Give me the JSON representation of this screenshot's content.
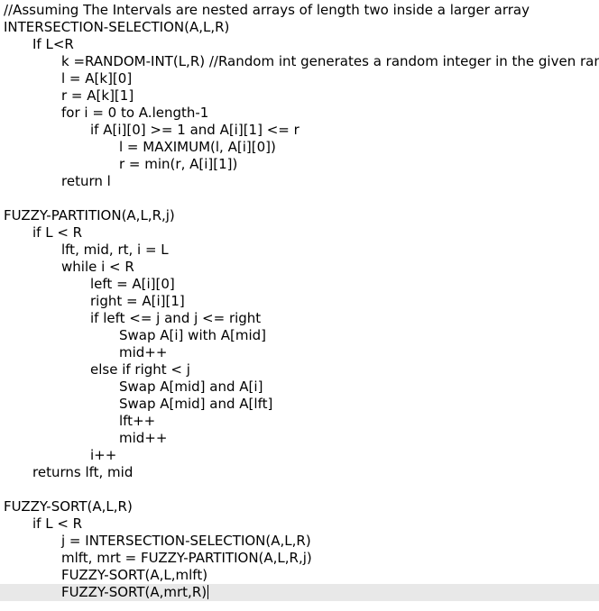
{
  "editor": {
    "indent_unit": "    ",
    "active_line": 34,
    "highlight_color": "#e8e8e8",
    "lines": [
      {
        "indent": 0,
        "text": "//Assuming The Intervals are nested arrays of length two inside a larger array"
      },
      {
        "indent": 0,
        "text": "INTERSECTION-SELECTION(A,L,R)"
      },
      {
        "indent": 1,
        "text": "If L<R"
      },
      {
        "indent": 2,
        "text": "k =RANDOM-INT(L,R) //Random int generates a random integer in the given range"
      },
      {
        "indent": 2,
        "text": "l = A[k][0]"
      },
      {
        "indent": 2,
        "text": "r = A[k][1]"
      },
      {
        "indent": 2,
        "text": "for i = 0 to A.length-1"
      },
      {
        "indent": 3,
        "text": "if A[i][0] >= 1 and A[i][1] <= r"
      },
      {
        "indent": 4,
        "text": "l = MAXIMUM(l, A[i][0])"
      },
      {
        "indent": 4,
        "text": "r = min(r, A[i][1])"
      },
      {
        "indent": 2,
        "text": "return l"
      },
      {
        "indent": 0,
        "text": ""
      },
      {
        "indent": 0,
        "text": "FUZZY-PARTITION(A,L,R,j)"
      },
      {
        "indent": 1,
        "text": "if L < R"
      },
      {
        "indent": 2,
        "text": "lft, mid, rt, i = L"
      },
      {
        "indent": 2,
        "text": "while i < R"
      },
      {
        "indent": 3,
        "text": "left = A[i][0]"
      },
      {
        "indent": 3,
        "text": "right = A[i][1]"
      },
      {
        "indent": 3,
        "text": "if left <= j and j <= right"
      },
      {
        "indent": 4,
        "text": "Swap A[i] with A[mid]"
      },
      {
        "indent": 4,
        "text": "mid++"
      },
      {
        "indent": 3,
        "text": "else if right < j"
      },
      {
        "indent": 4,
        "text": "Swap A[mid] and A[i]"
      },
      {
        "indent": 4,
        "text": "Swap A[mid] and A[lft]"
      },
      {
        "indent": 4,
        "text": "lft++"
      },
      {
        "indent": 4,
        "text": "mid++"
      },
      {
        "indent": 3,
        "text": "i++"
      },
      {
        "indent": 1,
        "text": "returns lft, mid"
      },
      {
        "indent": 0,
        "text": ""
      },
      {
        "indent": 0,
        "text": "FUZZY-SORT(A,L,R)"
      },
      {
        "indent": 1,
        "text": "if L < R"
      },
      {
        "indent": 2,
        "text": "j = INTERSECTION-SELECTION(A,L,R)"
      },
      {
        "indent": 2,
        "text": "mlft, mrt = FUZZY-PARTITION(A,L,R,j)"
      },
      {
        "indent": 2,
        "text": "FUZZY-SORT(A,L,mlft)"
      },
      {
        "indent": 2,
        "text": "FUZZY-SORT(A,mrt,R)"
      }
    ]
  }
}
